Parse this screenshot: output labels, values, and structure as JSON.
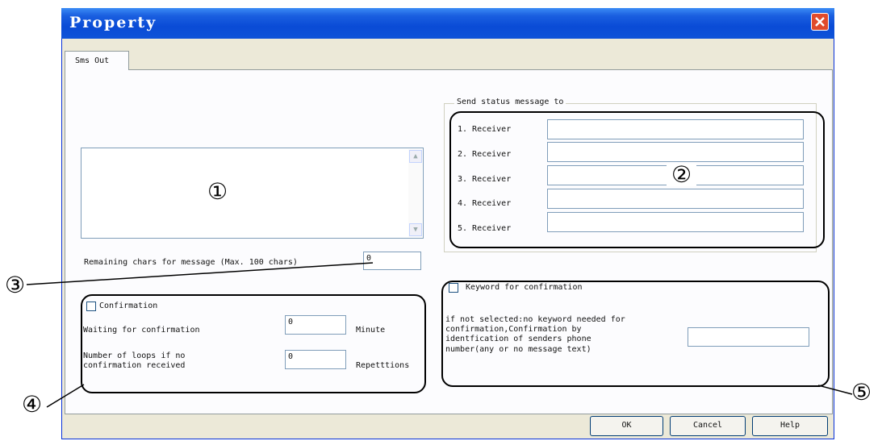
{
  "window": {
    "title": "Property"
  },
  "tabs": [
    {
      "label": "Sms Out"
    }
  ],
  "message": {
    "text": "",
    "annotation": "①"
  },
  "remaining": {
    "label": "Remaining chars for message (Max. 100 chars)",
    "value": "0",
    "annotation": "③"
  },
  "receivers": {
    "group_title": "Send status message to",
    "annotation": "②",
    "items": [
      {
        "label": "1. Receiver",
        "value": ""
      },
      {
        "label": "2. Receiver",
        "value": ""
      },
      {
        "label": "3. Receiver",
        "value": ""
      },
      {
        "label": "4. Receiver",
        "value": ""
      },
      {
        "label": "5. Receiver",
        "value": ""
      }
    ]
  },
  "confirmation": {
    "checkbox_label": "Confirmation",
    "annotation": "④",
    "waiting_label": "Waiting for confirmation",
    "waiting_value": "0",
    "waiting_unit": "Minute",
    "loops_label_1": "Number of loops if no",
    "loops_label_2": "confirmation received",
    "loops_value": "0",
    "loops_unit": "Repetttions"
  },
  "keyword": {
    "checkbox_label": "Keyword for confirmation",
    "annotation": "⑤",
    "desc_1": "if not selected:no keyword needed for",
    "desc_2": "confirmation,Confirmation by",
    "desc_3": "identfication of senders phone",
    "desc_4": "number(any or no message text)",
    "value": ""
  },
  "buttons": {
    "ok": "OK",
    "cancel": "Cancel",
    "help": "Help"
  }
}
